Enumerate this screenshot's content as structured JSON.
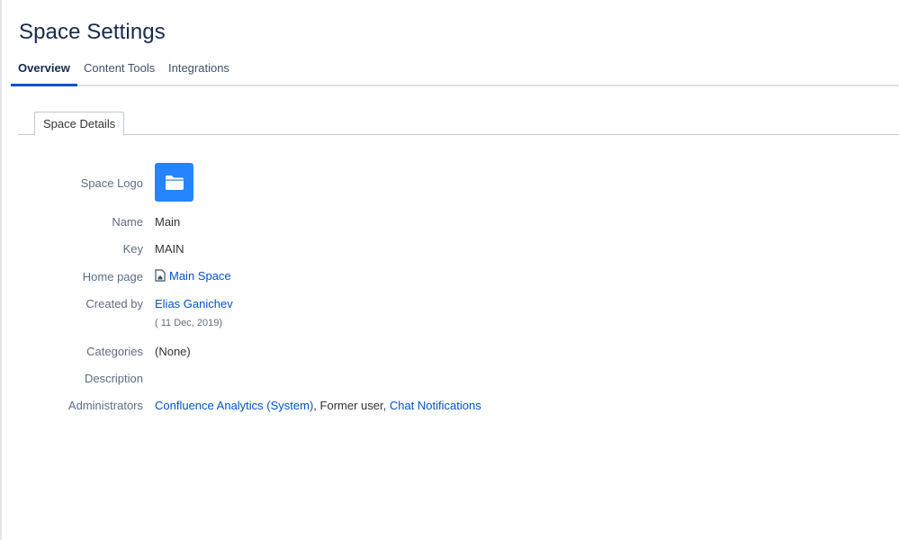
{
  "page": {
    "title": "Space Settings"
  },
  "tabs": [
    {
      "label": "Overview",
      "active": true
    },
    {
      "label": "Content Tools",
      "active": false
    },
    {
      "label": "Integrations",
      "active": false
    }
  ],
  "subtab": {
    "label": "Space Details"
  },
  "details": {
    "logo_label": "Space Logo",
    "name_label": "Name",
    "name_value": "Main",
    "key_label": "Key",
    "key_value": "MAIN",
    "homepage_label": "Home page",
    "homepage_value": "Main Space",
    "created_label": "Created by",
    "created_by": "Elias Ganichev",
    "created_date": "( 11 Dec, 2019)",
    "categories_label": "Categories",
    "categories_value": "(None)",
    "description_label": "Description",
    "admins_label": "Administrators",
    "admins": {
      "admin1": "Confluence Analytics (System)",
      "sep1": ", Former user, ",
      "admin2": "Chat Notifications"
    }
  },
  "colors": {
    "accent": "#0052cc",
    "logo_bg": "#2684ff",
    "label": "#5e6c84"
  },
  "icons": {
    "logo": "folder-icon",
    "homepage": "home-page-icon"
  }
}
